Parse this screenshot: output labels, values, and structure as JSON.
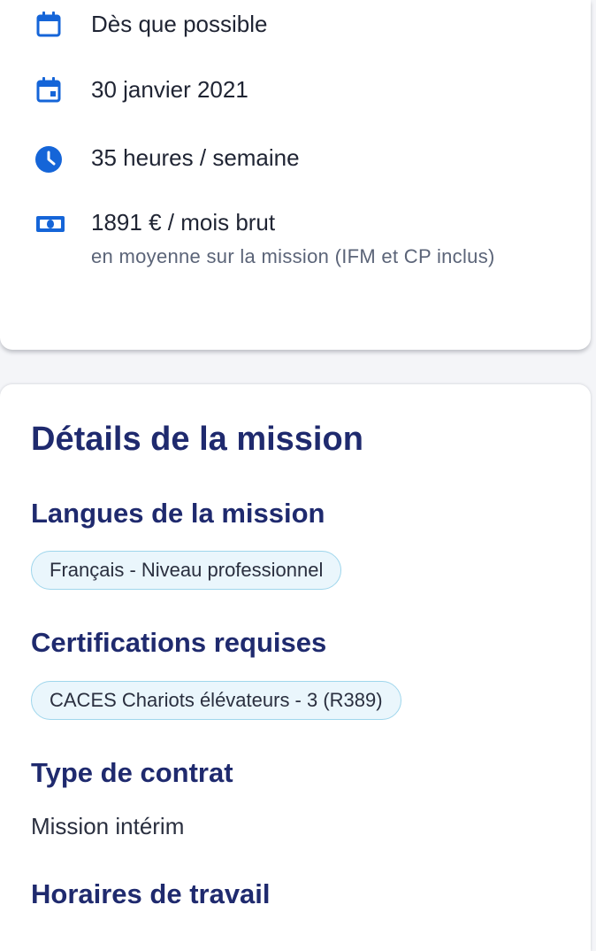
{
  "summary": {
    "start": "Dès que possible",
    "end_date": "30 janvier 2021",
    "hours": "35 heures / semaine",
    "salary": "1891 € / mois brut",
    "salary_note": "en moyenne sur la mission (IFM et CP inclus)"
  },
  "icons": {
    "calendar": "calendar-icon",
    "clock": "clock-icon",
    "money": "banknote-icon"
  },
  "details": {
    "title": "Détails de la mission",
    "languages_heading": "Langues de la mission",
    "language_chip": "Français - Niveau professionnel",
    "certifications_heading": "Certifications requises",
    "certification_chip": "CACES Chariots élévateurs - 3 (R389)",
    "contract_heading": "Type de contrat",
    "contract_value": "Mission intérim",
    "hours_heading": "Horaires de travail"
  },
  "colors": {
    "accent_blue": "#1565d8",
    "heading_navy": "#1f2a6e",
    "chip_border": "#9fd6ec",
    "chip_bg": "#eaf6fc"
  }
}
